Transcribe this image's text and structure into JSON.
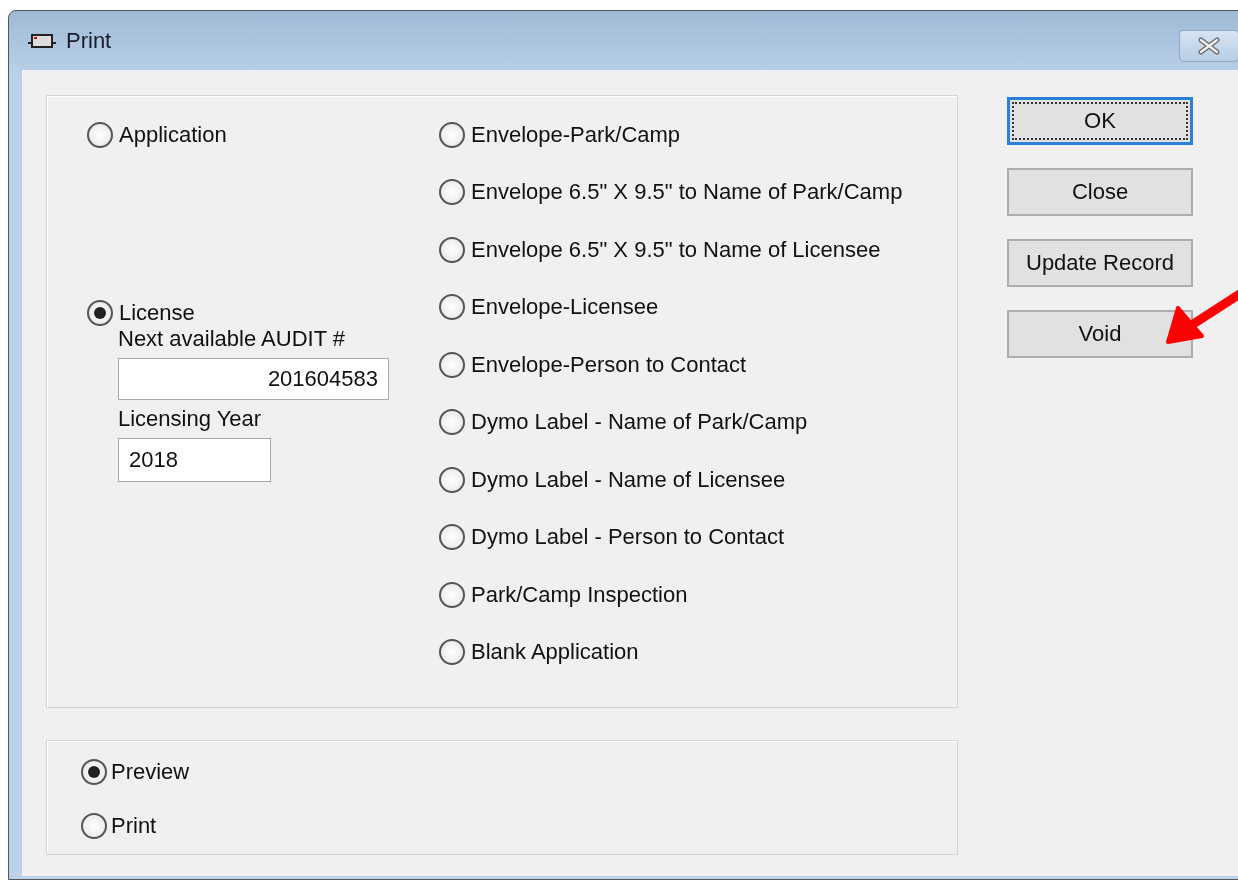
{
  "window": {
    "title": "Print"
  },
  "left_options": [
    {
      "label": "Application",
      "selected": false
    },
    {
      "label": "License",
      "selected": true,
      "fields": [
        {
          "label": "Next available AUDIT #",
          "value": "201604583"
        },
        {
          "label": "Licensing Year",
          "value": "2018"
        }
      ]
    }
  ],
  "right_options": [
    {
      "label": "Envelope-Park/Camp",
      "selected": false
    },
    {
      "label": "Envelope 6.5\" X 9.5\" to Name of Park/Camp",
      "selected": false
    },
    {
      "label": "Envelope 6.5\" X 9.5\" to Name of Licensee",
      "selected": false
    },
    {
      "label": "Envelope-Licensee",
      "selected": false
    },
    {
      "label": "Envelope-Person to Contact",
      "selected": false
    },
    {
      "label": "Dymo Label - Name of Park/Camp",
      "selected": false
    },
    {
      "label": "Dymo Label - Name of Licensee",
      "selected": false
    },
    {
      "label": "Dymo Label - Person to Contact",
      "selected": false
    },
    {
      "label": "Park/Camp Inspection",
      "selected": false
    },
    {
      "label": "Blank Application",
      "selected": false
    }
  ],
  "output_options": [
    {
      "label": "Preview",
      "selected": true
    },
    {
      "label": "Print",
      "selected": false
    }
  ],
  "buttons": [
    {
      "label": "OK",
      "focused": true
    },
    {
      "label": "Close",
      "focused": false
    },
    {
      "label": "Update Record",
      "focused": false
    },
    {
      "label": "Void",
      "focused": false
    }
  ]
}
